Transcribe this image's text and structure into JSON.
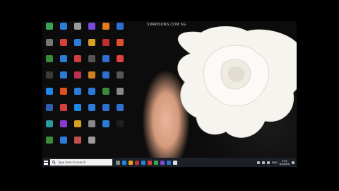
{
  "watermark": "SWANSONS.COM.SG",
  "taskbar": {
    "search_placeholder": "Type here to search",
    "language": "ENG",
    "time": "3:53",
    "date": "6/1/2020"
  },
  "icons": [
    {
      "label": "",
      "color": "#3aa655"
    },
    {
      "label": "",
      "color": "#2b7bd8"
    },
    {
      "label": "",
      "color": "#9a9a9a"
    },
    {
      "label": "",
      "color": "#7a4bd8"
    },
    {
      "label": "",
      "color": "#e87a1e"
    },
    {
      "label": "",
      "color": "#2f6fd0"
    },
    {
      "label": "",
      "color": "#777"
    },
    {
      "label": "",
      "color": "#d84040"
    },
    {
      "label": "",
      "color": "#2b7bd8"
    },
    {
      "label": "",
      "color": "#d8a020"
    },
    {
      "label": "",
      "color": "#c03030"
    },
    {
      "label": "",
      "color": "#e05030"
    },
    {
      "label": "",
      "color": "#3a8a3a"
    },
    {
      "label": "",
      "color": "#2b7bd8"
    },
    {
      "label": "",
      "color": "#d04040"
    },
    {
      "label": "",
      "color": "#555"
    },
    {
      "label": "",
      "color": "#2f6fd0"
    },
    {
      "label": "",
      "color": "#e04040"
    },
    {
      "label": "",
      "color": "#3a3a3a"
    },
    {
      "label": "",
      "color": "#2b7bd8"
    },
    {
      "label": "",
      "color": "#c03050"
    },
    {
      "label": "",
      "color": "#d08020"
    },
    {
      "label": "",
      "color": "#2f6fd0"
    },
    {
      "label": "",
      "color": "#555"
    },
    {
      "label": "",
      "color": "#1e88e5"
    },
    {
      "label": "",
      "color": "#e05020"
    },
    {
      "label": "",
      "color": "#2b7bd8"
    },
    {
      "label": "",
      "color": "#2b7bd8"
    },
    {
      "label": "",
      "color": "#3a8a3a"
    },
    {
      "label": "",
      "color": "#888"
    },
    {
      "label": "",
      "color": "#2f5fb0"
    },
    {
      "label": "",
      "color": "#d84040"
    },
    {
      "label": "",
      "color": "#1e88e5"
    },
    {
      "label": "",
      "color": "#2b7bd8"
    },
    {
      "label": "",
      "color": "#2f6fd0"
    },
    {
      "label": "",
      "color": "#2f6fd0"
    },
    {
      "label": "",
      "color": "#2a9aa0"
    },
    {
      "label": "",
      "color": "#8a3ad0"
    },
    {
      "label": "",
      "color": "#d8a020"
    },
    {
      "label": "",
      "color": "#888"
    },
    {
      "label": "",
      "color": "#2b7bd8"
    },
    {
      "label": "",
      "color": "#1e1e1e"
    },
    {
      "label": "",
      "color": "#3a8a3a"
    },
    {
      "label": "",
      "color": "#2b7bd8"
    },
    {
      "label": "",
      "color": "#c05050"
    },
    {
      "label": "",
      "color": "#9a9a9a"
    }
  ],
  "taskbar_apps": [
    "#888",
    "#1e88e5",
    "#e8a020",
    "#c03030",
    "#2b7bd8",
    "#d84040",
    "#3aa655",
    "#7a4bd8",
    "#2f6fd0",
    "#ddd"
  ]
}
